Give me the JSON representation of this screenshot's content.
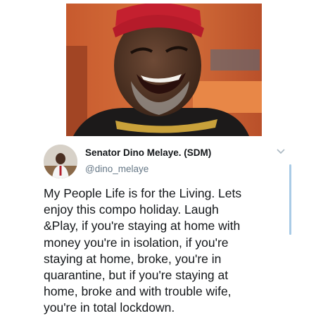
{
  "tweet": {
    "display_name": "Senator Dino Melaye. (SDM)",
    "handle": "@dino_melaye",
    "text": "My People Life is for the Living. Lets\nenjoy this compo holiday. Laugh\n&Play, if you're staying at home with\nmoney you're in isolation,  if you're\nstaying at home, broke, you're in\nquarantine, but if you're staying at\nhome, broke  and with trouble wife,\nyou're in total lockdown."
  },
  "icons": {
    "more": "chevron-down-icon"
  },
  "colors": {
    "name_text": "#14171a",
    "handle_text": "#657786",
    "body_text": "#14171a",
    "scroll_accent": "#a9cbe6"
  }
}
